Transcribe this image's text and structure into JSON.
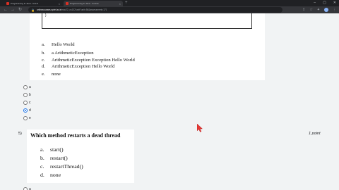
{
  "browser": {
    "tabs": [
      {
        "title": "Programming In Java - Unit 6",
        "active": false
      },
      {
        "title": "Programming In Java - Course",
        "active": true
      }
    ],
    "url_host": "onlinecourses.nptel.ac.in",
    "url_path": "/noc22_cs102/unit?unit=56&assessment=171"
  },
  "q1": {
    "options": [
      {
        "letter": "a.",
        "text": "Hello World"
      },
      {
        "letter": "b.",
        "text": "a ArithmeticException"
      },
      {
        "letter": "c.",
        "text": "ArithmeticException Exception Hello World"
      },
      {
        "letter": "d.",
        "text": "ArithmeticException Hello World"
      },
      {
        "letter": "e.",
        "text": "none"
      }
    ],
    "answers": [
      {
        "label": "a",
        "checked": false
      },
      {
        "label": "b",
        "checked": false
      },
      {
        "label": "c",
        "checked": false
      },
      {
        "label": "d",
        "checked": true
      },
      {
        "label": "e",
        "checked": false
      }
    ]
  },
  "q2": {
    "number": "5)",
    "points": "1 point",
    "title": "Which method restarts a dead thread",
    "options": [
      {
        "letter": "a.",
        "text": "start()"
      },
      {
        "letter": "b.",
        "text": "restart()"
      },
      {
        "letter": "c.",
        "text": "restartThread()"
      },
      {
        "letter": "d.",
        "text": "none"
      }
    ],
    "answers": [
      {
        "label": "a",
        "checked": false
      }
    ]
  }
}
